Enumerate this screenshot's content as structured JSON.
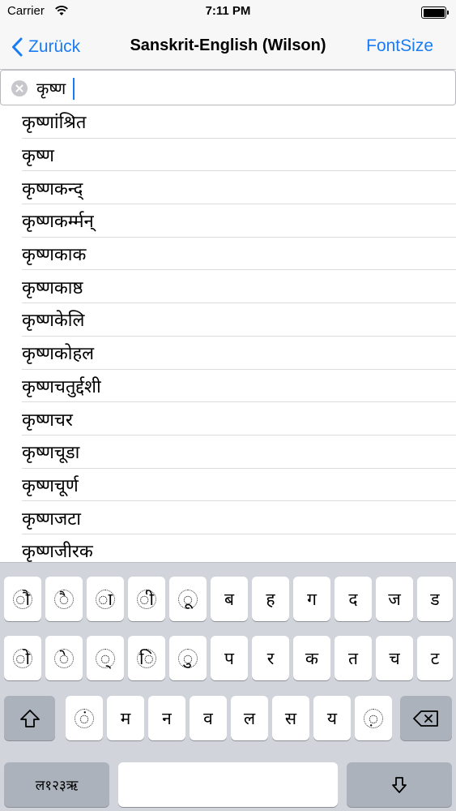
{
  "status_bar": {
    "carrier": "Carrier",
    "time": "7:11 PM",
    "wifi_icon": "wifi-icon",
    "battery_icon": "battery-icon"
  },
  "nav_bar": {
    "back_label": "Zurück",
    "title": "Sanskrit-English (Wilson)",
    "right_button": "FontSize"
  },
  "search": {
    "value": "कृष्ण",
    "clear_icon": "clear-icon"
  },
  "results": [
    "कृष्णांश्रित",
    "कृष्ण",
    "कृष्णकन्द्",
    "कृष्णकर्म्मन्",
    "कृष्णकाक",
    "कृष्णकाष्ठ",
    "कृष्णकेलि",
    "कृष्णकोहल",
    "कृष्णचतुर्द्दशी",
    "कृष्णचर",
    "कृष्णचूडा",
    "कृष्णचूर्ण",
    "कृष्णजटा",
    "कृष्णजीरक"
  ],
  "keyboard": {
    "row1": [
      "ौ",
      "ै",
      "ा",
      "ी",
      "ू",
      "ब",
      "ह",
      "ग",
      "द",
      "ज",
      "ड"
    ],
    "row2": [
      "ो",
      "े",
      "्",
      "ि",
      "ु",
      "प",
      "र",
      "क",
      "त",
      "च",
      "ट"
    ],
    "row3": [
      "ं",
      "म",
      "न",
      "व",
      "ल",
      "स",
      "य",
      "़"
    ],
    "mode_label": "ल१२३ऋ",
    "shift_icon": "shift-icon",
    "backspace_icon": "backspace-icon",
    "return_icon": "return-icon",
    "colors": {
      "background": "#d1d5db",
      "key": "#ffffff",
      "dark_key": "#abb2bb",
      "accent": "#1a7cf5"
    }
  }
}
